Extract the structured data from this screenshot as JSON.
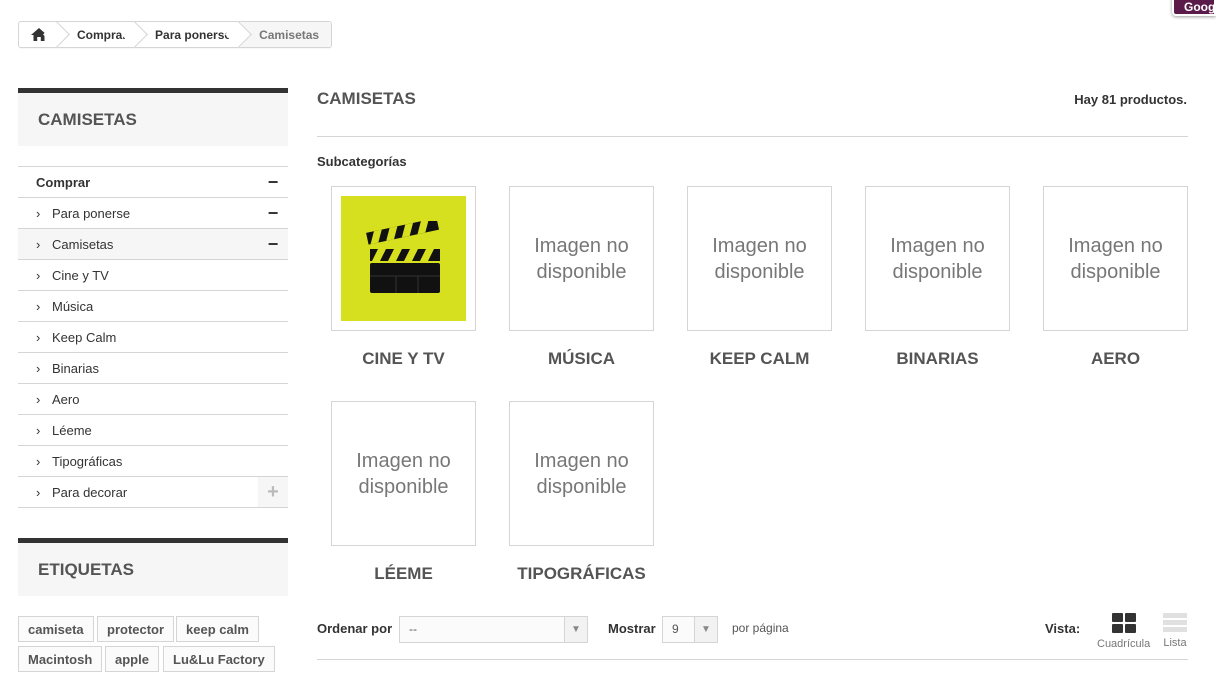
{
  "breadcrumb": {
    "home_icon": "home-icon",
    "items": [
      "Comprar",
      "Para ponerse",
      "Camisetas"
    ]
  },
  "google_tab": "Goog",
  "sidebar": {
    "category_title": "CAMISETAS",
    "tree": [
      {
        "label": "Comprar",
        "level": "top",
        "toggle": "−"
      },
      {
        "label": "Para ponerse",
        "level": "sub",
        "toggle": "−"
      },
      {
        "label": "Camisetas",
        "level": "sub",
        "toggle": "−",
        "active": true
      },
      {
        "label": "Cine y TV",
        "level": "sub"
      },
      {
        "label": "Música",
        "level": "sub"
      },
      {
        "label": "Keep Calm",
        "level": "sub"
      },
      {
        "label": "Binarias",
        "level": "sub"
      },
      {
        "label": "Aero",
        "level": "sub"
      },
      {
        "label": "Léeme",
        "level": "sub"
      },
      {
        "label": "Tipográficas",
        "level": "sub"
      },
      {
        "label": "Para decorar",
        "level": "sub",
        "toggle": "+"
      }
    ],
    "tags_title": "ETIQUETAS",
    "tags": [
      "camiseta",
      "protector",
      "keep calm",
      "Macintosh",
      "apple",
      "Lu&Lu Factory"
    ]
  },
  "main": {
    "heading": "CAMISETAS",
    "product_count": "Hay 81 productos.",
    "subcategories_label": "Subcategorías",
    "no_image_text": "Imagen no disponible",
    "subcategories": [
      {
        "name": "CINE Y TV",
        "image": "clapperboard-icon"
      },
      {
        "name": "MÚSICA"
      },
      {
        "name": "KEEP CALM"
      },
      {
        "name": "BINARIAS"
      },
      {
        "name": "AERO"
      },
      {
        "name": "LÉEME"
      },
      {
        "name": "TIPOGRÁFICAS"
      }
    ]
  },
  "sortbar": {
    "sort_label": "Ordenar por",
    "sort_value": "--",
    "show_label": "Mostrar",
    "show_value": "9",
    "per_page": "por página",
    "view_label": "Vista:",
    "grid_label": "Cuadrícula",
    "list_label": "Lista"
  },
  "colors": {
    "accent_clapper_bg": "#d6e01e",
    "border": "#d6d4d4",
    "heading_text": "#555454",
    "google_tab": "#5b1b4a"
  }
}
